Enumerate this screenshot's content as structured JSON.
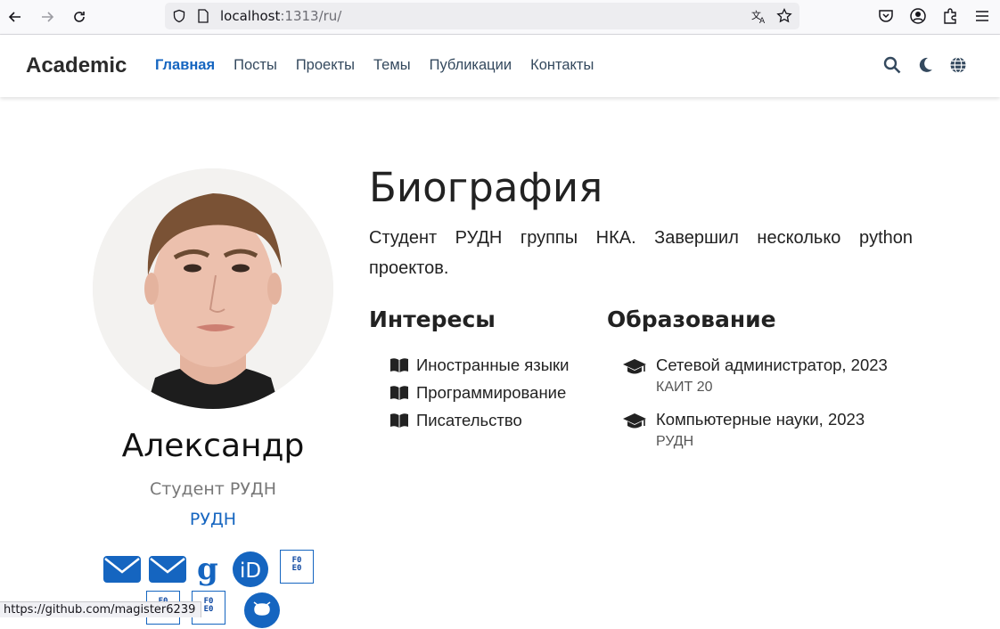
{
  "browser": {
    "url_host": "localhost",
    "url_rest": ":1313/ru/",
    "status_url": "https://github.com/magister6239"
  },
  "site": {
    "brand": "Academic",
    "menu": [
      {
        "label": "Главная",
        "active": true
      },
      {
        "label": "Посты",
        "active": false
      },
      {
        "label": "Проекты",
        "active": false
      },
      {
        "label": "Темы",
        "active": false
      },
      {
        "label": "Публикации",
        "active": false
      },
      {
        "label": "Контакты",
        "active": false
      }
    ]
  },
  "profile": {
    "name": "Александр",
    "role": "Студент РУДН",
    "organization": "РУДН",
    "social_icons": [
      "envelope-icon",
      "envelope-icon",
      "google-scholar-icon",
      "orcid-icon",
      "logo-icon",
      "logo-icon",
      "logo-icon",
      "github-icon"
    ]
  },
  "biography": {
    "title": "Биография",
    "text": "Студент РУДН группы НКА. Завершил несколько python проектов."
  },
  "interests": {
    "title": "Интересы",
    "items": [
      "Иностранные языки",
      "Программирование",
      "Писательство"
    ]
  },
  "education": {
    "title": "Образование",
    "items": [
      {
        "course": "Сетевой администратор, 2023",
        "institution": "КАИТ 20"
      },
      {
        "course": "Компьютерные науки, 2023",
        "institution": "РУДН"
      }
    ]
  },
  "colors": {
    "accent": "#1565c0",
    "text": "#222222",
    "muted": "#777777"
  },
  "logo_text": "F0\nE0"
}
